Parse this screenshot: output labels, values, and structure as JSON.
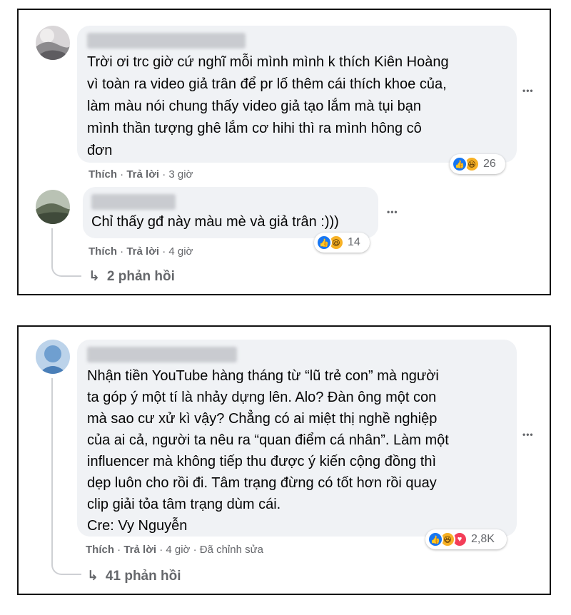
{
  "comments": [
    {
      "lines": [
        "Trời ơi trc giờ cứ nghĩ mỗi mình mình k thích Kiên Hoàng",
        "vì toàn ra video giả trân để pr lố thêm cái thích khoe của,",
        "làm màu nói chung thấy video giả tạo lắm mà tụi bạn",
        "mình thần tượng ghê lắm cơ hihi thì ra mình hông cô",
        "đơn"
      ],
      "like": "Thích",
      "reply": "Trả lời",
      "time": "3 giờ",
      "reaction_count": "26",
      "reactions": [
        "like-icon",
        "haha-icon"
      ]
    },
    {
      "lines": [
        "Chỉ thấy gđ này màu mè và giả trân :)))"
      ],
      "like": "Thích",
      "reply": "Trả lời",
      "time": "4 giờ",
      "reaction_count": "14",
      "reactions": [
        "like-icon",
        "haha-icon"
      ],
      "replies_label": "2 phản hồi"
    },
    {
      "lines": [
        "Nhận tiền YouTube hàng tháng từ “lũ trẻ con” mà người",
        "ta góp ý một tí là nhảy dựng lên. Alo? Đàn ông một con",
        "mà sao cư xử kì vậy? Chẳng có ai miệt thị nghề nghiệp",
        "của ai cả, người ta nêu ra “quan điểm cá nhân”. Làm một",
        "influencer mà không tiếp thu được ý kiến cộng đồng thì",
        "dẹp luôn cho rồi đi. Tâm trạng đừng có tốt hơn rồi quay",
        "clip giải tỏa tâm trạng dùm cái.",
        "Cre: Vy Nguyễn"
      ],
      "like": "Thích",
      "reply": "Trả lời",
      "time": "4 giờ",
      "edited": "Đã chỉnh sửa",
      "reaction_count": "2,8K",
      "reactions": [
        "like-icon",
        "haha-icon",
        "love-icon"
      ],
      "replies_label": "41 phản hồi"
    }
  ],
  "separator": " · ",
  "more_glyph": "•••",
  "reply_arrow": "↳",
  "colors": {
    "like": "#1877f2",
    "haha": "#f7b125",
    "love": "#f33e58",
    "bubble": "#f0f2f5",
    "meta": "#65676b"
  }
}
